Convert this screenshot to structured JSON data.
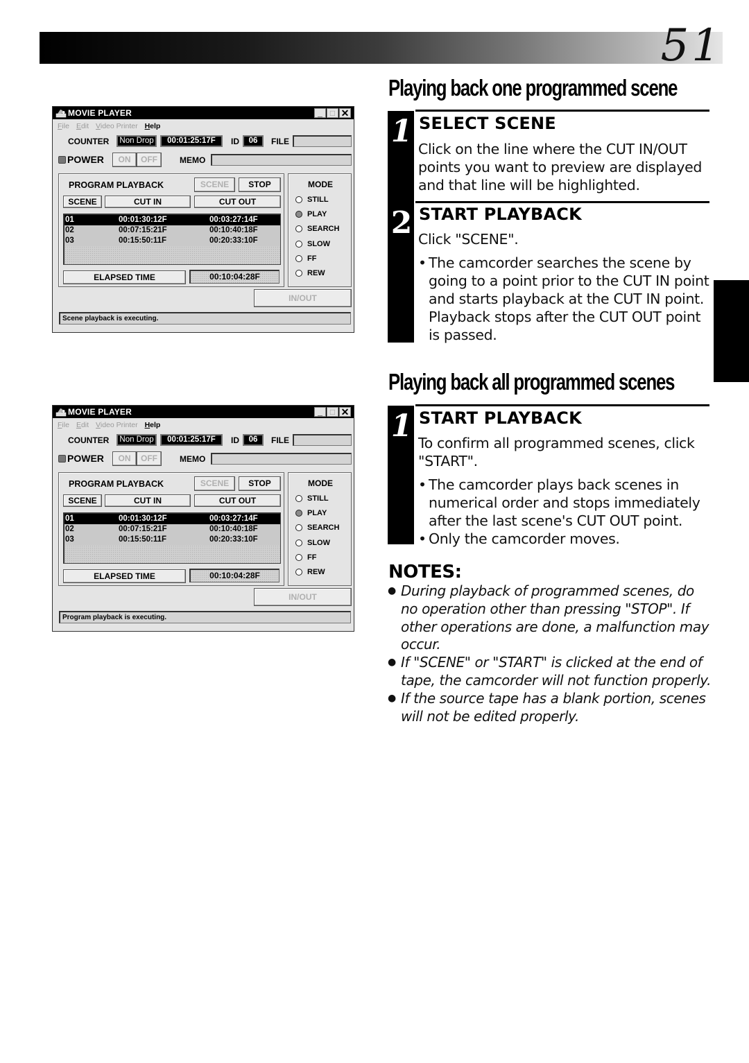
{
  "page": {
    "number": "51"
  },
  "screens": [
    {
      "window_title": "MOVIE PLAYER",
      "window_buttons": {
        "minimize": "_",
        "maximize": "□",
        "close": "✕"
      },
      "menu": [
        {
          "label": "File",
          "ul": "F",
          "rest": "ile",
          "enabled": false
        },
        {
          "label": "Edit",
          "ul": "E",
          "rest": "dit",
          "enabled": false
        },
        {
          "label": "Video Printer",
          "ul": "V",
          "rest": "ideo Printer",
          "enabled": false
        },
        {
          "label": "Help",
          "ul": "H",
          "rest": "elp",
          "enabled": true
        }
      ],
      "counter_label": "COUNTER",
      "counter_mode": "Non Drop",
      "counter_value": "00:01:25:17F",
      "id_label": "ID",
      "id_value": "06",
      "file_label": "FILE",
      "file_value": "",
      "power_label": "POWER",
      "on_label": "ON",
      "off_label": "OFF",
      "memo_label": "MEMO",
      "memo_value": "",
      "program_playback_label": "PROGRAM PLAYBACK",
      "scene_button": "SCENE",
      "stop_button": "STOP",
      "columns": [
        "SCENE",
        "CUT IN",
        "CUT OUT"
      ],
      "rows": [
        {
          "scene": "01",
          "cut_in": "00:01:30:12F",
          "cut_out": "00:03:27:14F",
          "selected": true
        },
        {
          "scene": "02",
          "cut_in": "00:07:15:21F",
          "cut_out": "00:10:40:18F",
          "selected": false
        },
        {
          "scene": "03",
          "cut_in": "00:15:50:11F",
          "cut_out": "00:20:33:10F",
          "selected": false
        }
      ],
      "elapsed_label": "ELAPSED TIME",
      "elapsed_value": "00:10:04:28F",
      "mode_label": "MODE",
      "modes": [
        "STILL",
        "PLAY",
        "SEARCH",
        "SLOW",
        "FF",
        "REW"
      ],
      "mode_selected": "PLAY",
      "inout_button": "IN/OUT",
      "status": "Scene playback is executing."
    },
    {
      "window_title": "MOVIE PLAYER",
      "window_buttons": {
        "minimize": "_",
        "maximize": "□",
        "close": "✕"
      },
      "menu": [
        {
          "label": "File",
          "ul": "F",
          "rest": "ile",
          "enabled": false
        },
        {
          "label": "Edit",
          "ul": "E",
          "rest": "dit",
          "enabled": false
        },
        {
          "label": "Video Printer",
          "ul": "V",
          "rest": "ideo Printer",
          "enabled": false
        },
        {
          "label": "Help",
          "ul": "H",
          "rest": "elp",
          "enabled": true
        }
      ],
      "counter_label": "COUNTER",
      "counter_mode": "Non Drop",
      "counter_value": "00:01:25:17F",
      "id_label": "ID",
      "id_value": "06",
      "file_label": "FILE",
      "file_value": "",
      "power_label": "POWER",
      "on_label": "ON",
      "off_label": "OFF",
      "memo_label": "MEMO",
      "memo_value": "",
      "program_playback_label": "PROGRAM PLAYBACK",
      "scene_button": "SCENE",
      "stop_button": "STOP",
      "columns": [
        "SCENE",
        "CUT IN",
        "CUT OUT"
      ],
      "rows": [
        {
          "scene": "01",
          "cut_in": "00:01:30:12F",
          "cut_out": "00:03:27:14F",
          "selected": true
        },
        {
          "scene": "02",
          "cut_in": "00:07:15:21F",
          "cut_out": "00:10:40:18F",
          "selected": false
        },
        {
          "scene": "03",
          "cut_in": "00:15:50:11F",
          "cut_out": "00:20:33:10F",
          "selected": false
        }
      ],
      "elapsed_label": "ELAPSED TIME",
      "elapsed_value": "00:10:04:28F",
      "mode_label": "MODE",
      "modes": [
        "STILL",
        "PLAY",
        "SEARCH",
        "SLOW",
        "FF",
        "REW"
      ],
      "mode_selected": "PLAY",
      "inout_button": "IN/OUT",
      "status": "Program playback is executing."
    }
  ],
  "section_one": {
    "heading": "Playing back one programmed scene",
    "steps": [
      {
        "number": "1",
        "title": "SELECT SCENE",
        "body": "Click on the line where the CUT IN/OUT points you want to preview are displayed and that line will be highlighted.",
        "bullets": []
      },
      {
        "number": "2",
        "title": "START PLAYBACK",
        "body": "Click \"SCENE\".",
        "bullets": [
          "The camcorder searches the scene by going to a point prior to the CUT IN point and starts playback at the CUT IN point. Playback stops after the CUT OUT point is passed."
        ]
      }
    ]
  },
  "section_two": {
    "heading": "Playing back all programmed scenes",
    "steps": [
      {
        "number": "1",
        "title": "START PLAYBACK",
        "body": "To confirm all programmed scenes, click \"START\".",
        "bullets": [
          "The camcorder plays back scenes in numerical order and stops immediately after the last scene's CUT OUT point.",
          "Only the camcorder moves."
        ]
      }
    ]
  },
  "notes": {
    "title": "NOTES:",
    "items": [
      "During playback of programmed scenes, do no operation other than pressing \"STOP\". If other operations are done, a malfunction may occur.",
      "If \"SCENE\" or \"START\" is clicked at the end of tape, the camcorder will not function properly.",
      "If the source tape has a blank portion, scenes will not be edited properly."
    ]
  }
}
